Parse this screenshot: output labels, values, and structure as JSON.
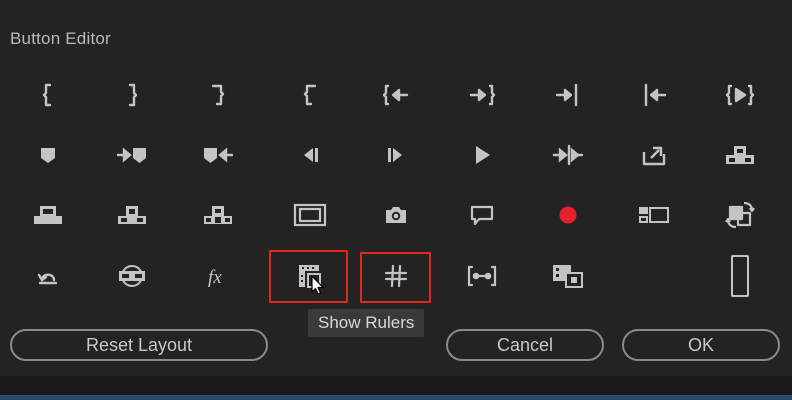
{
  "dialog": {
    "title": "Button Editor",
    "tooltip": "Show Rulers",
    "buttons": {
      "reset_layout": "Reset Layout",
      "cancel": "Cancel",
      "ok": "OK"
    }
  },
  "icons": {
    "row1": [
      "mark-in-icon",
      "mark-out-icon",
      "mark-clip-out-icon",
      "mark-clip-in-icon",
      "go-to-in-out-icon",
      "go-to-out-point-icon",
      "go-to-out-icon",
      "go-to-in-icon",
      "play-in-to-out-icon"
    ],
    "row2": [
      "add-marker-icon",
      "go-to-next-marker-icon",
      "go-to-previous-marker-icon",
      "step-back-icon",
      "step-forward-icon",
      "play-icon",
      "shuttle-icon",
      "export-frame-icon",
      "lift-icon"
    ],
    "row3": [
      "insert-icon",
      "overwrite-icon",
      "extract-icon",
      "safe-margins-icon",
      "camera-icon",
      "comment-icon",
      "record-icon",
      "multi-camera-icon",
      "proxy-toggle-icon"
    ],
    "row4": [
      "loop-icon",
      "vr-video-icon",
      "fx-icon",
      "show-rulers-icon",
      "show-guides-icon",
      "trim-icon",
      "comparison-view-icon",
      "",
      "spacer-icon"
    ]
  },
  "colors": {
    "highlight": "#e0281e",
    "record": "#e8202a",
    "icon": "#c4c4c4"
  }
}
